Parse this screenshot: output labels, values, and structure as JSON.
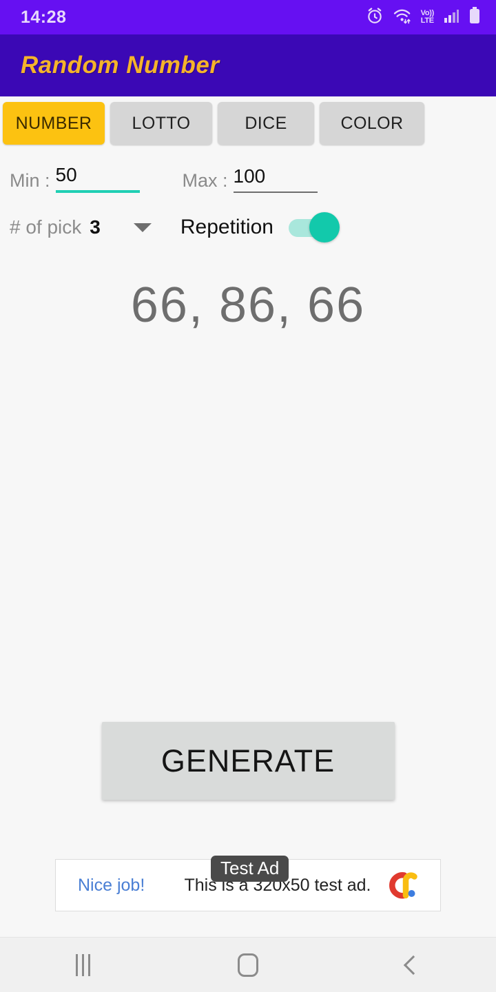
{
  "status_bar": {
    "time": "14:28",
    "icons": [
      "alarm-icon",
      "wifi-icon",
      "volte-icon",
      "signal-icon",
      "battery-icon"
    ],
    "volte_top": "Vo))",
    "volte_bottom": "LTE",
    "background_color": "#6610f2",
    "text_color": "#e7d9fb"
  },
  "app_bar": {
    "title": "Random Number",
    "background_color": "#3b08b5",
    "title_color": "#f5b32b"
  },
  "tabs": [
    {
      "label": "NUMBER",
      "active": true
    },
    {
      "label": "LOTTO",
      "active": false
    },
    {
      "label": "DICE",
      "active": false
    },
    {
      "label": "COLOR",
      "active": false
    }
  ],
  "tab_colors": {
    "active_background": "#fcc211",
    "active_text": "#3a2a00",
    "inactive_background": "#d6d6d6",
    "inactive_text": "#1f1f1f"
  },
  "range": {
    "min_label": "Min :",
    "min_value": "50",
    "min_focused": true,
    "max_label": "Max :",
    "max_value": "100",
    "max_focused": false,
    "focus_color": "#20cfb4",
    "idle_color": "#6d6d6d"
  },
  "pick": {
    "label": "# of pick",
    "value": "3",
    "dropdown_icon": "chevron-down-icon"
  },
  "repetition": {
    "label": "Repetition",
    "enabled": true,
    "on_color": "#12c9ab",
    "track_color": "#a9e7dc"
  },
  "result": {
    "value": "66, 86, 66",
    "color": "#6e6e6e"
  },
  "generate": {
    "label": "GENERATE",
    "background_color": "#d9dbda"
  },
  "ad": {
    "badge": "Test Ad",
    "link_text": "Nice job!",
    "body_text": "This is a 320x50 test ad.",
    "link_color": "#4a7fd4",
    "logo_name": "admob-logo-icon"
  },
  "nav_bar": {
    "recents_label": "recents-icon",
    "home_label": "home-icon",
    "back_label": "back-icon"
  }
}
